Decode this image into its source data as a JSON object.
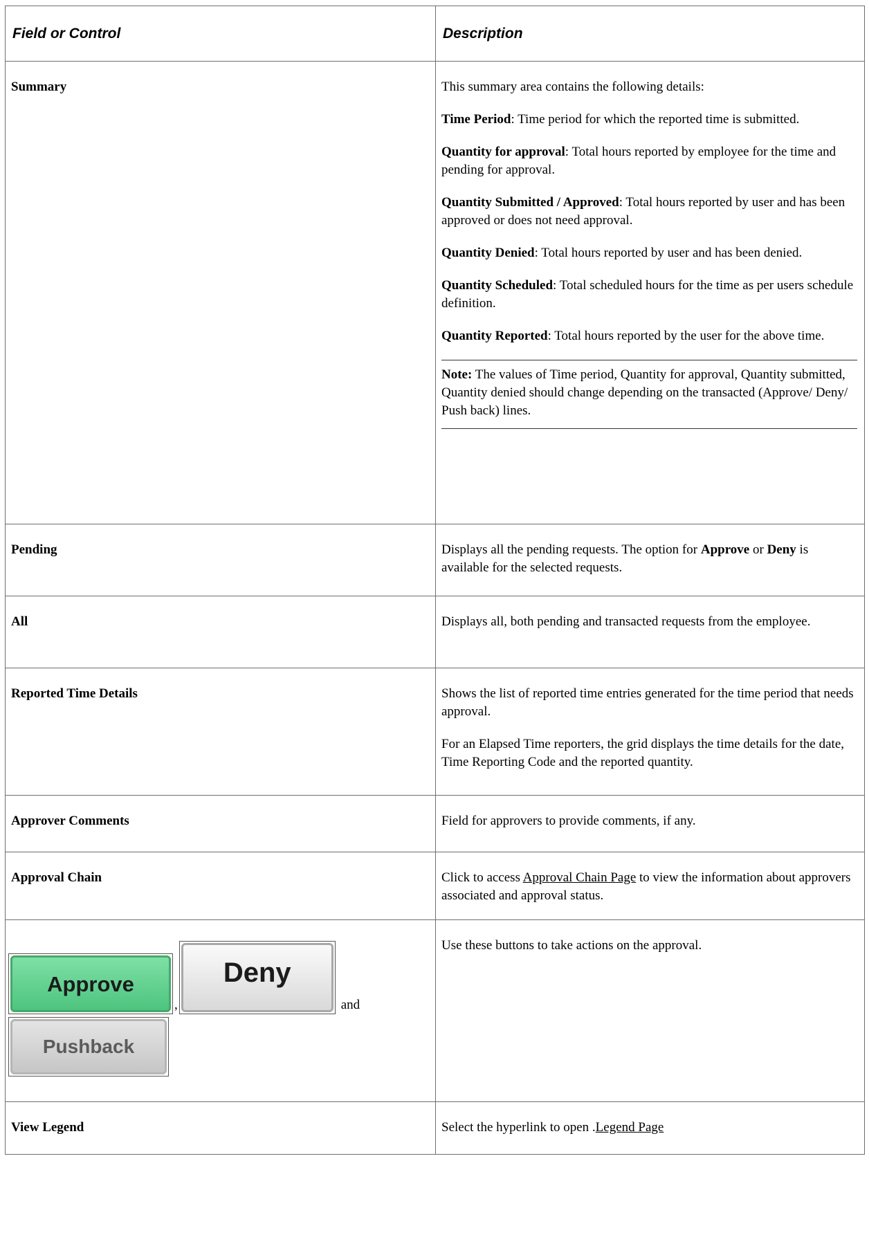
{
  "header": {
    "col1": "Field or Control",
    "col2": "Description"
  },
  "summary": {
    "field": "Summary",
    "intro": "This summary area contains the following details:",
    "items": [
      {
        "term": "Time Period",
        "text": ": Time period for which the reported time is submitted."
      },
      {
        "term": "Quantity for approval",
        "text": ": Total hours reported by employee for the time and pending for approval."
      },
      {
        "term": "Quantity Submitted / Approved",
        "text": ": Total hours reported by user and has been approved or does not need approval."
      },
      {
        "term": "Quantity Denied",
        "text": ": Total hours reported by user and has been denied."
      },
      {
        "term": "Quantity Scheduled",
        "text": ": Total scheduled hours for the time as per users schedule definition."
      },
      {
        "term": "Quantity Reported",
        "text": ": Total hours reported by the user for the above time."
      }
    ],
    "note_label": "Note:",
    "note_text": " The values of Time period, Quantity for approval,  Quantity submitted, Quantity denied should change depending on the transacted (Approve/ Deny/ Push back) lines."
  },
  "pending": {
    "field": "Pending",
    "text_a": "Displays all the pending requests. The option for ",
    "bold_a": "Approve",
    "text_b": " or ",
    "bold_b": "Deny",
    "text_c": " is available for the selected requests."
  },
  "all": {
    "field": "All",
    "text": "Displays all, both pending and transacted requests from the employee."
  },
  "reported": {
    "field": "Reported Time Details",
    "p1": "Shows the list of reported time entries generated for the time period that needs approval.",
    "p2": "For an Elapsed Time reporters, the grid displays the time details for the date, Time Reporting Code and the reported quantity."
  },
  "comments": {
    "field": "Approver Comments",
    "text": "Field for approvers to provide comments, if any."
  },
  "chain": {
    "field": "Approval Chain",
    "text_a": "Click to access ",
    "link": "Approval Chain Page",
    "text_b": " to view the information about approvers associated and approval status."
  },
  "buttons": {
    "approve_label": "Approve",
    "deny_label": "Deny",
    "pushback_label": "Pushback",
    "comma": ",",
    "and": "and",
    "text": "Use these buttons to take actions on the approval."
  },
  "legend": {
    "field": "View Legend",
    "text_a": "Select the hyperlink to open .",
    "link": "Legend Page"
  }
}
